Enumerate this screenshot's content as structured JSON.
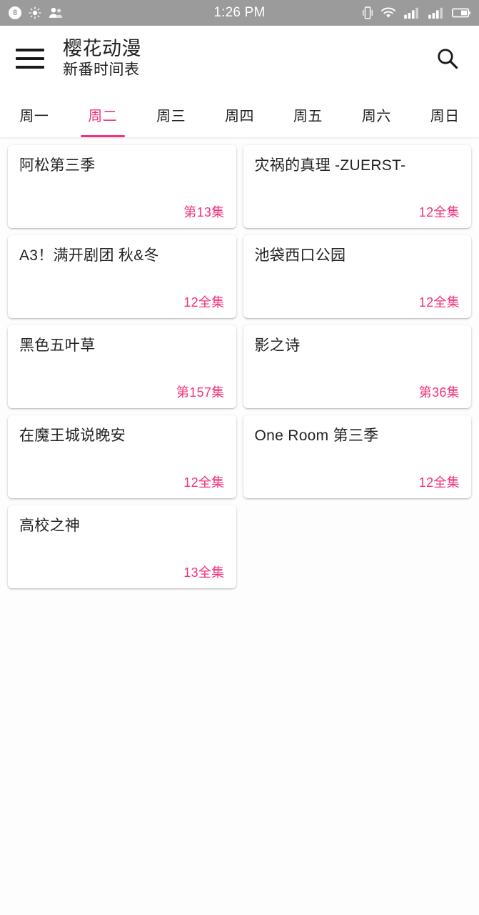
{
  "status_bar": {
    "time": "1:26 PM",
    "background_color": "#9b9b9b",
    "left_icons": [
      {
        "name": "notification-count-badge",
        "label": "8"
      },
      {
        "name": "brightness-icon",
        "label": ""
      },
      {
        "name": "contacts-icon",
        "label": ""
      }
    ],
    "right_icons": [
      {
        "name": "vibrate-icon",
        "label": ""
      },
      {
        "name": "wifi-icon",
        "label": ""
      },
      {
        "name": "signal-sim1-icon",
        "label": ""
      },
      {
        "name": "signal-sim2-icon",
        "label": ""
      },
      {
        "name": "battery-icon",
        "label": ""
      }
    ]
  },
  "app_bar": {
    "menu_icon": "hamburger-menu-icon",
    "title": "樱花动漫",
    "subtitle": "新番时间表",
    "search_icon": "search-icon"
  },
  "theme": {
    "accent_color": "#f2327c",
    "text_color": "#232323",
    "card_background": "#ffffff",
    "page_background": "#fdfdfd"
  },
  "tabs": {
    "active_index": 1,
    "items": [
      {
        "label": "周一"
      },
      {
        "label": "周二"
      },
      {
        "label": "周三"
      },
      {
        "label": "周四"
      },
      {
        "label": "周五"
      },
      {
        "label": "周六"
      },
      {
        "label": "周日"
      }
    ]
  },
  "anime_list": [
    {
      "title": "阿松第三季",
      "episode": "第13集"
    },
    {
      "title": "灾祸的真理 -ZUERST-",
      "episode": "12全集"
    },
    {
      "title": "A3！满开剧团 秋&冬",
      "episode": "12全集"
    },
    {
      "title": "池袋西口公园",
      "episode": "12全集"
    },
    {
      "title": "黑色五叶草",
      "episode": "第157集"
    },
    {
      "title": "影之诗",
      "episode": "第36集"
    },
    {
      "title": "在魔王城说晚安",
      "episode": "12全集"
    },
    {
      "title": "One Room 第三季",
      "episode": "12全集"
    },
    {
      "title": "高校之神",
      "episode": "13全集"
    }
  ]
}
